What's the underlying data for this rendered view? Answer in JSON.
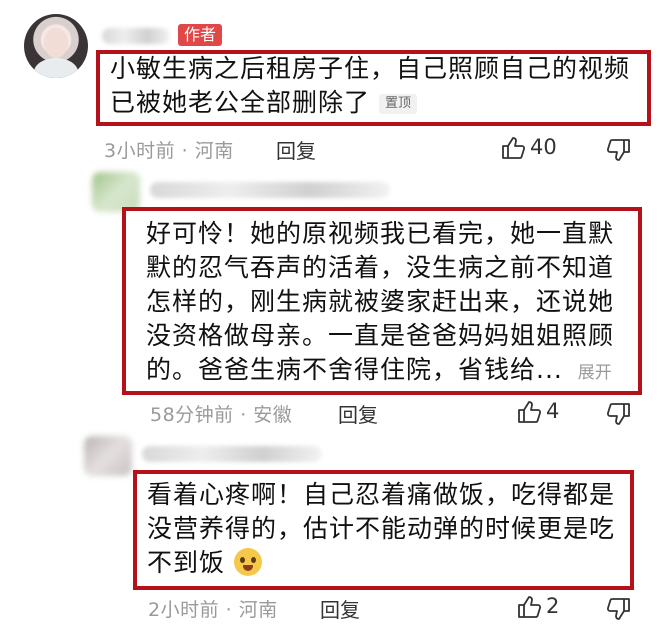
{
  "comments": [
    {
      "badge": "作者",
      "text_line1": "小敏生病之后租房子住，自己照顾自己的视频",
      "text_line2": "已被她老公全部删除了",
      "pinned_label": "置顶",
      "meta": "3小时前 · 河南",
      "reply_label": "回复",
      "like_count": "40"
    },
    {
      "text_lines": [
        "好可怜！她的原视频我已看完，她一直默",
        "默的忍气吞声的活着，没生病之前不知道",
        "怎样的，刚生病就被婆家赶出来，还说她",
        "没资格做母亲。一直是爸爸妈妈姐姐照顾",
        "的。爸爸生病不舍得住院，省钱给..."
      ],
      "expand_label": "展开",
      "meta": "58分钟前 · 安徽",
      "reply_label": "回复",
      "like_count": "4"
    },
    {
      "text_lines": [
        "看着心疼啊！自己忍着痛做饭，吃得都是",
        "没营养得的，估计不能动弹的时候更是吃",
        "不到饭"
      ],
      "emoji_name": "pleading-face-emoji",
      "meta": "2小时前 · 河南",
      "reply_label": "回复",
      "like_count": "2"
    }
  ],
  "colors": {
    "highlight_border": "#b5111b",
    "author_badge": "#e04848",
    "meta_text": "#9a9a9a"
  },
  "icons": [
    "thumbs-up-icon",
    "thumbs-down-icon"
  ]
}
